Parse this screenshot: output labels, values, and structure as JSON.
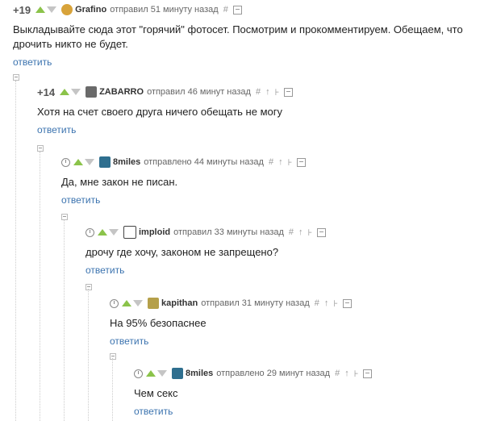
{
  "comments": [
    {
      "rating": "+19",
      "user": "Grafino",
      "meta": "отправил 51 минуту назад",
      "text": "Выкладывайте сюда этот \"горячий\" фотосет. Посмотрим и прокомментируем. Обещаем, что дрочить никто не будет.",
      "reply": "ответить"
    },
    {
      "rating": "+14",
      "user": "ZABARRO",
      "meta": "отправил 46 минут назад",
      "text": "Хотя на счет своего друга ничего обещать не могу",
      "reply": "ответить"
    },
    {
      "user": "8miles",
      "meta": "отправлено 44 минуты назад",
      "text": "Да, мне закон не писан.",
      "reply": "ответить"
    },
    {
      "user": "imploid",
      "meta": "отправил 33 минуты назад",
      "text": "дрочу где хочу, законом не запрещено?",
      "reply": "ответить"
    },
    {
      "user": "kapithan",
      "meta": "отправил 31 минуту назад",
      "text": "На 95% безопаснее",
      "reply": "ответить"
    },
    {
      "user": "8miles",
      "meta": "отправлено 29 минут назад",
      "text": "Чем секс",
      "reply": "ответить"
    }
  ],
  "icons": {
    "hash": "#",
    "up": "↑",
    "branch": "⊦"
  },
  "colors": {
    "link": "#3b73af",
    "up": "#8bc34a",
    "down": "#c5c5c5"
  }
}
